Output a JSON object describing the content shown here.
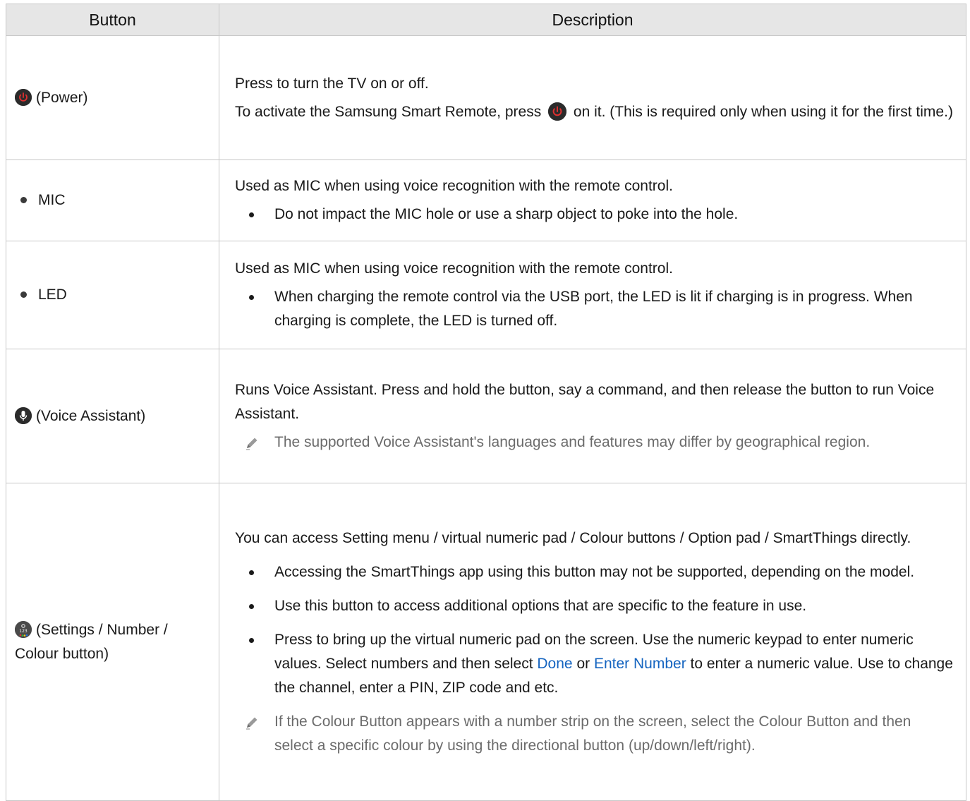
{
  "headers": {
    "button": "Button",
    "description": "Description"
  },
  "rows": [
    {
      "button": "(Power)",
      "icon": "power-icon",
      "p1": "Press to turn the TV on or off.",
      "p2a": "To activate the Samsung Smart Remote, press",
      "p2b": "on it. (This is required only when using it for the first time.)"
    },
    {
      "button": "MIC",
      "p1": "Used as MIC when using voice recognition with the remote control.",
      "bullet1": "Do not impact the MIC hole or use a sharp object to poke into the hole."
    },
    {
      "button": "LED",
      "p1": "Used as MIC when using voice recognition with the remote control.",
      "bullet1": "When charging the remote control via the USB port, the LED is lit if charging is in progress. When charging is complete, the LED is turned off."
    },
    {
      "button": "(Voice Assistant)",
      "icon": "microphone-icon",
      "p1": "Runs Voice Assistant. Press and hold the button, say a command, and then release the button to run Voice Assistant.",
      "note": "The supported Voice Assistant's languages and features may differ by geographical region."
    },
    {
      "button": "(Settings / Number / Colour button)",
      "icon": "settings-number-icon",
      "p1": "You can access Setting menu / virtual numeric pad / Colour buttons / Option pad / SmartThings directly.",
      "bullet1": "Accessing the SmartThings app using this button may not be supported, depending on the model.",
      "bullet2": "Use this button to access additional options that are specific to the feature in use.",
      "bullet3a": "Press to bring up the virtual numeric pad on the screen. Use the numeric keypad to enter numeric values. Select numbers and then select",
      "bullet3_link1": "Done",
      "bullet3_or": "or",
      "bullet3_link2": "Enter Number",
      "bullet3b": "to enter a numeric value. Use to change the channel, enter a PIN, ZIP code and etc.",
      "note": "If the Colour Button appears with a number strip on the screen, select the Colour Button and then select a specific colour by using the directional button (up/down/left/right)."
    }
  ],
  "colors": {
    "header_bg": "#e6e6e6",
    "border": "#c8c8c8",
    "link": "#1464c0",
    "note_text": "#6b6b6b",
    "power_icon": "#e03030"
  }
}
